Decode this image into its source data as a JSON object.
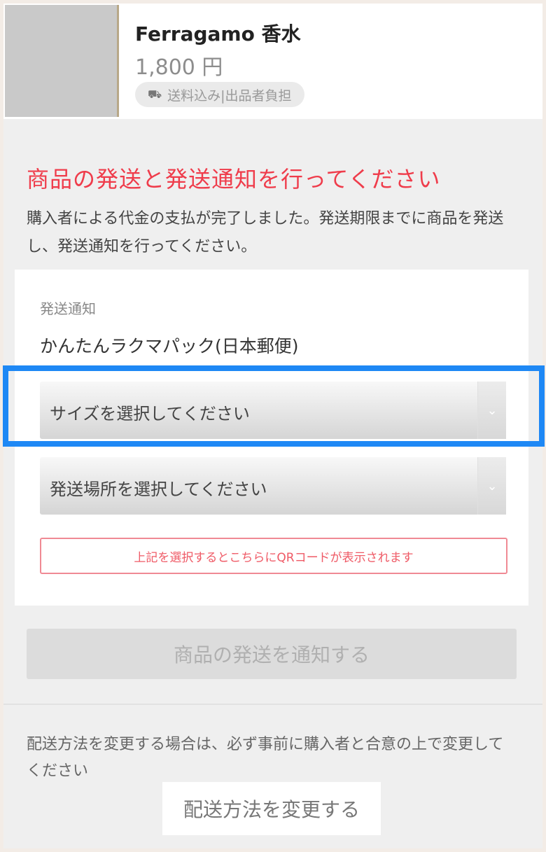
{
  "item": {
    "name": "Ferragamo 香水",
    "price": "1,800 円",
    "shipping_tag": "送料込み|出品者負担"
  },
  "alert": {
    "title": "商品の発送と発送通知を行ってください",
    "description": "購入者による代金の支払が完了しました。発送期限までに商品を発送し、発送通知を行ってください。"
  },
  "shipping_panel": {
    "label": "発送通知",
    "method": "かんたんラクマパック(日本郵便)",
    "size_select": "サイズを選択してください",
    "place_select": "発送場所を選択してください",
    "qr_note": "上記を選択するとこちらにQRコードが表示されます"
  },
  "notify_button": "商品の発送を通知する",
  "change_method": {
    "text": "配送方法を変更する場合は、必ず事前に購入者と合意の上で変更してください",
    "button": "配送方法を変更する"
  },
  "icons": {
    "truck": "truck-icon",
    "chevron": "chevron-down-icon"
  },
  "colors": {
    "alert": "#ef3c4b",
    "highlight": "#1e88f5"
  }
}
